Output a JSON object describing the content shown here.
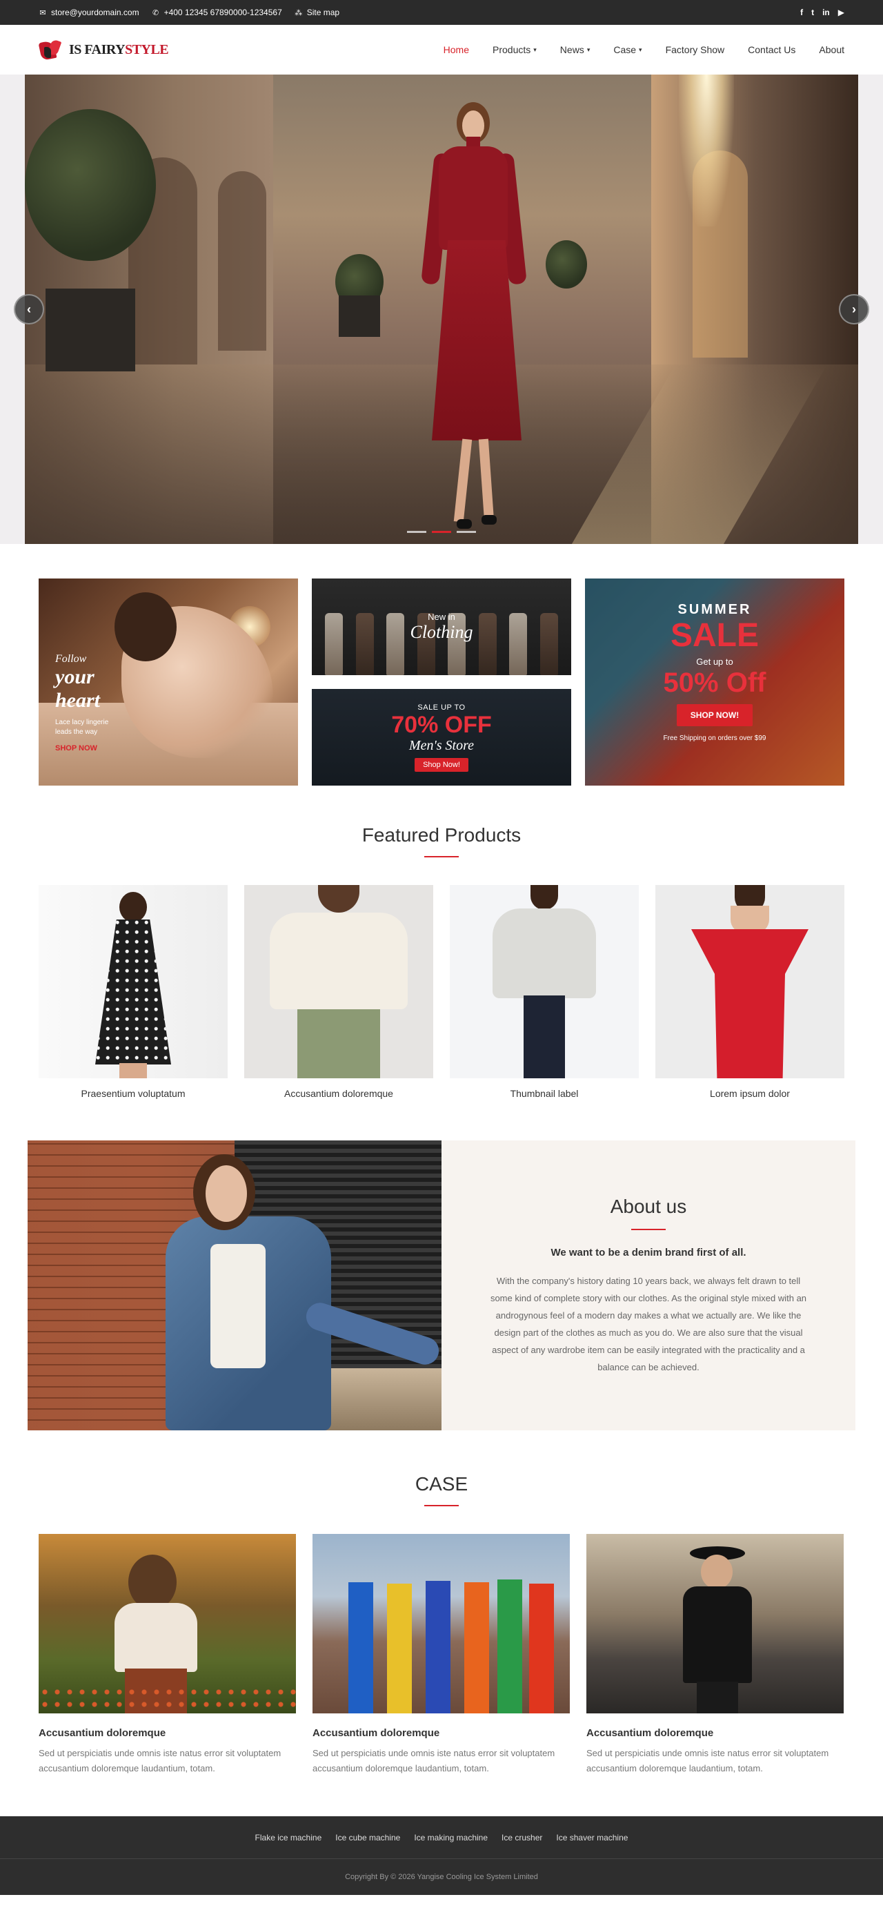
{
  "topbar": {
    "email": "store@yourdomain.com",
    "phone": "+400 12345 67890000-1234567",
    "sitemap": "Site map",
    "social": [
      "f",
      "t",
      "in",
      "▶"
    ]
  },
  "header": {
    "logo_text_1": "IS FAIRY",
    "logo_text_2": "STYLE",
    "nav": [
      {
        "label": "Home",
        "active": true,
        "dropdown": false
      },
      {
        "label": "Products",
        "active": false,
        "dropdown": true
      },
      {
        "label": "News",
        "active": false,
        "dropdown": true
      },
      {
        "label": "Case",
        "active": false,
        "dropdown": true
      },
      {
        "label": "Factory Show",
        "active": false,
        "dropdown": false
      },
      {
        "label": "Contact Us",
        "active": false,
        "dropdown": false
      },
      {
        "label": "About",
        "active": false,
        "dropdown": false
      }
    ]
  },
  "hero": {
    "prev": "‹",
    "next": "›",
    "slides": 3,
    "active_slide": 2
  },
  "promos": {
    "a": {
      "follow": "Follow",
      "big1": "your",
      "big2": "heart",
      "small1": "Lace lacy lingerie",
      "small2": "leads the way",
      "link": "SHOP NOW"
    },
    "b": {
      "newin": "New in",
      "clothing": "Clothing"
    },
    "c": {
      "saleup": "SALE UP TO",
      "off": "70% OFF",
      "mens": "Men's Store",
      "btn": "Shop Now!"
    },
    "d": {
      "summer": "SUMMER",
      "sale": "SALE",
      "getup": "Get up to",
      "pct": "50% Off",
      "btn": "SHOP NOW!",
      "free": "Free Shipping on orders over $99"
    }
  },
  "featured": {
    "title": "Featured Products",
    "items": [
      {
        "name": "Praesentium voluptatum"
      },
      {
        "name": "Accusantium doloremque"
      },
      {
        "name": "Thumbnail label"
      },
      {
        "name": "Lorem ipsum dolor"
      }
    ]
  },
  "about": {
    "title": "About us",
    "sub": "We want to be a denim brand first of all.",
    "desc": "With the company's history dating 10 years back, we always felt drawn to tell some kind of complete story with our clothes. As the original style mixed with an androgynous feel of a modern day makes a what we actually are. We like the design part of the clothes as much as you do. We are also sure that the visual aspect of any wardrobe item can be easily integrated with the practicality and a balance can be achieved."
  },
  "case": {
    "title": "CASE",
    "items": [
      {
        "title": "Accusantium doloremque",
        "desc": "Sed ut perspiciatis unde omnis iste natus error sit voluptatem accusantium doloremque laudantium, totam."
      },
      {
        "title": "Accusantium doloremque",
        "desc": "Sed ut perspiciatis unde omnis iste natus error sit voluptatem accusantium doloremque laudantium, totam."
      },
      {
        "title": "Accusantium doloremque",
        "desc": "Sed ut perspiciatis unde omnis iste natus error sit voluptatem accusantium doloremque laudantium, totam."
      }
    ]
  },
  "footer": {
    "links": [
      "Flake ice machine",
      "Ice cube machine",
      "Ice making machine",
      "Ice crusher",
      "Ice shaver machine"
    ],
    "copyright": "Copyright By © 2026 Yangise Cooling Ice System Limited"
  },
  "colors": {
    "accent": "#d8232a",
    "topbar": "#2b2b2b",
    "footer": "#2e2e2e",
    "about_bg": "#f7f3ef"
  }
}
